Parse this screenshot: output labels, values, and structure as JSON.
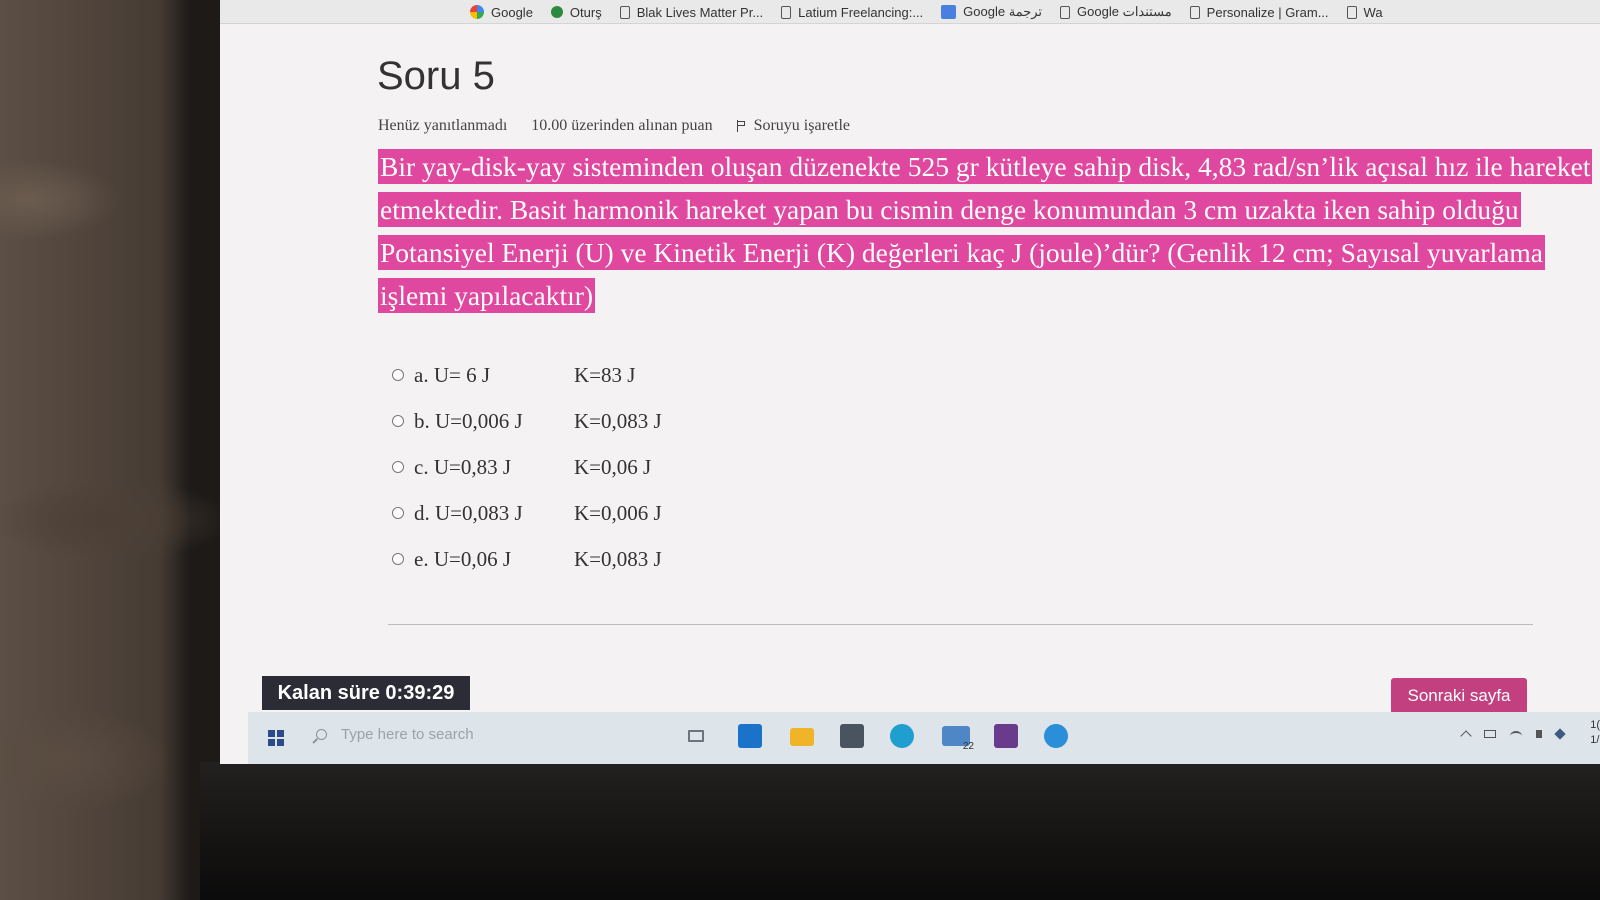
{
  "browser": {
    "bookmarks": [
      {
        "label": "Google",
        "icon": "google-icon"
      },
      {
        "label": "Oturş",
        "icon": "green-site-icon"
      },
      {
        "label": "Blak Lives Matter Pr...",
        "icon": "page-icon"
      },
      {
        "label": "Latium Freelancing:...",
        "icon": "page-icon"
      },
      {
        "label": "Google ترجمة",
        "icon": "translate-icon"
      },
      {
        "label": "Google مستندات",
        "icon": "page-icon"
      },
      {
        "label": "Personalize | Gram...",
        "icon": "page-icon"
      },
      {
        "label": "Wa",
        "icon": "page-icon"
      }
    ]
  },
  "quiz": {
    "title": "Soru 5",
    "status": "Henüz yanıtlanmadı",
    "points": "10.00 üzerinden alınan puan",
    "flag_label": "Soruyu işaretle",
    "question": "Bir yay-disk-yay sisteminden oluşan düzenekte 525 gr kütleye sahip disk, 4,83 rad/sn’lik açısal hız ile hareket etmektedir. Basit harmonik hareket yapan bu cismin denge konumundan 3 cm uzakta iken sahip olduğu Potansiyel Enerji (U) ve Kinetik Enerji (K) değerleri kaç J (joule)’dür? (Genlik 12 cm; Sayısal yuvarlama işlemi yapılacaktır)",
    "answers": [
      {
        "u": "a. U= 6 J",
        "k": "K=83 J"
      },
      {
        "u": "b. U=0,006 J",
        "k": "K=0,083 J"
      },
      {
        "u": "c. U=0,83 J",
        "k": "K=0,06 J"
      },
      {
        "u": "d. U=0,083 J",
        "k": "K=0,006 J"
      },
      {
        "u": "e. U=0,06 J",
        "k": "K=0,083 J"
      }
    ],
    "timer": "Kalan süre 0:39:29",
    "next_button": "Sonraki sayfa"
  },
  "taskbar": {
    "search_placeholder": "Type here to search",
    "mail_badge": "22",
    "clock_top": "1(",
    "clock_bottom": "1/"
  },
  "colors": {
    "highlight": "#e0479e",
    "next_button": "#c2407f",
    "timer_bg": "#2b2c36"
  }
}
